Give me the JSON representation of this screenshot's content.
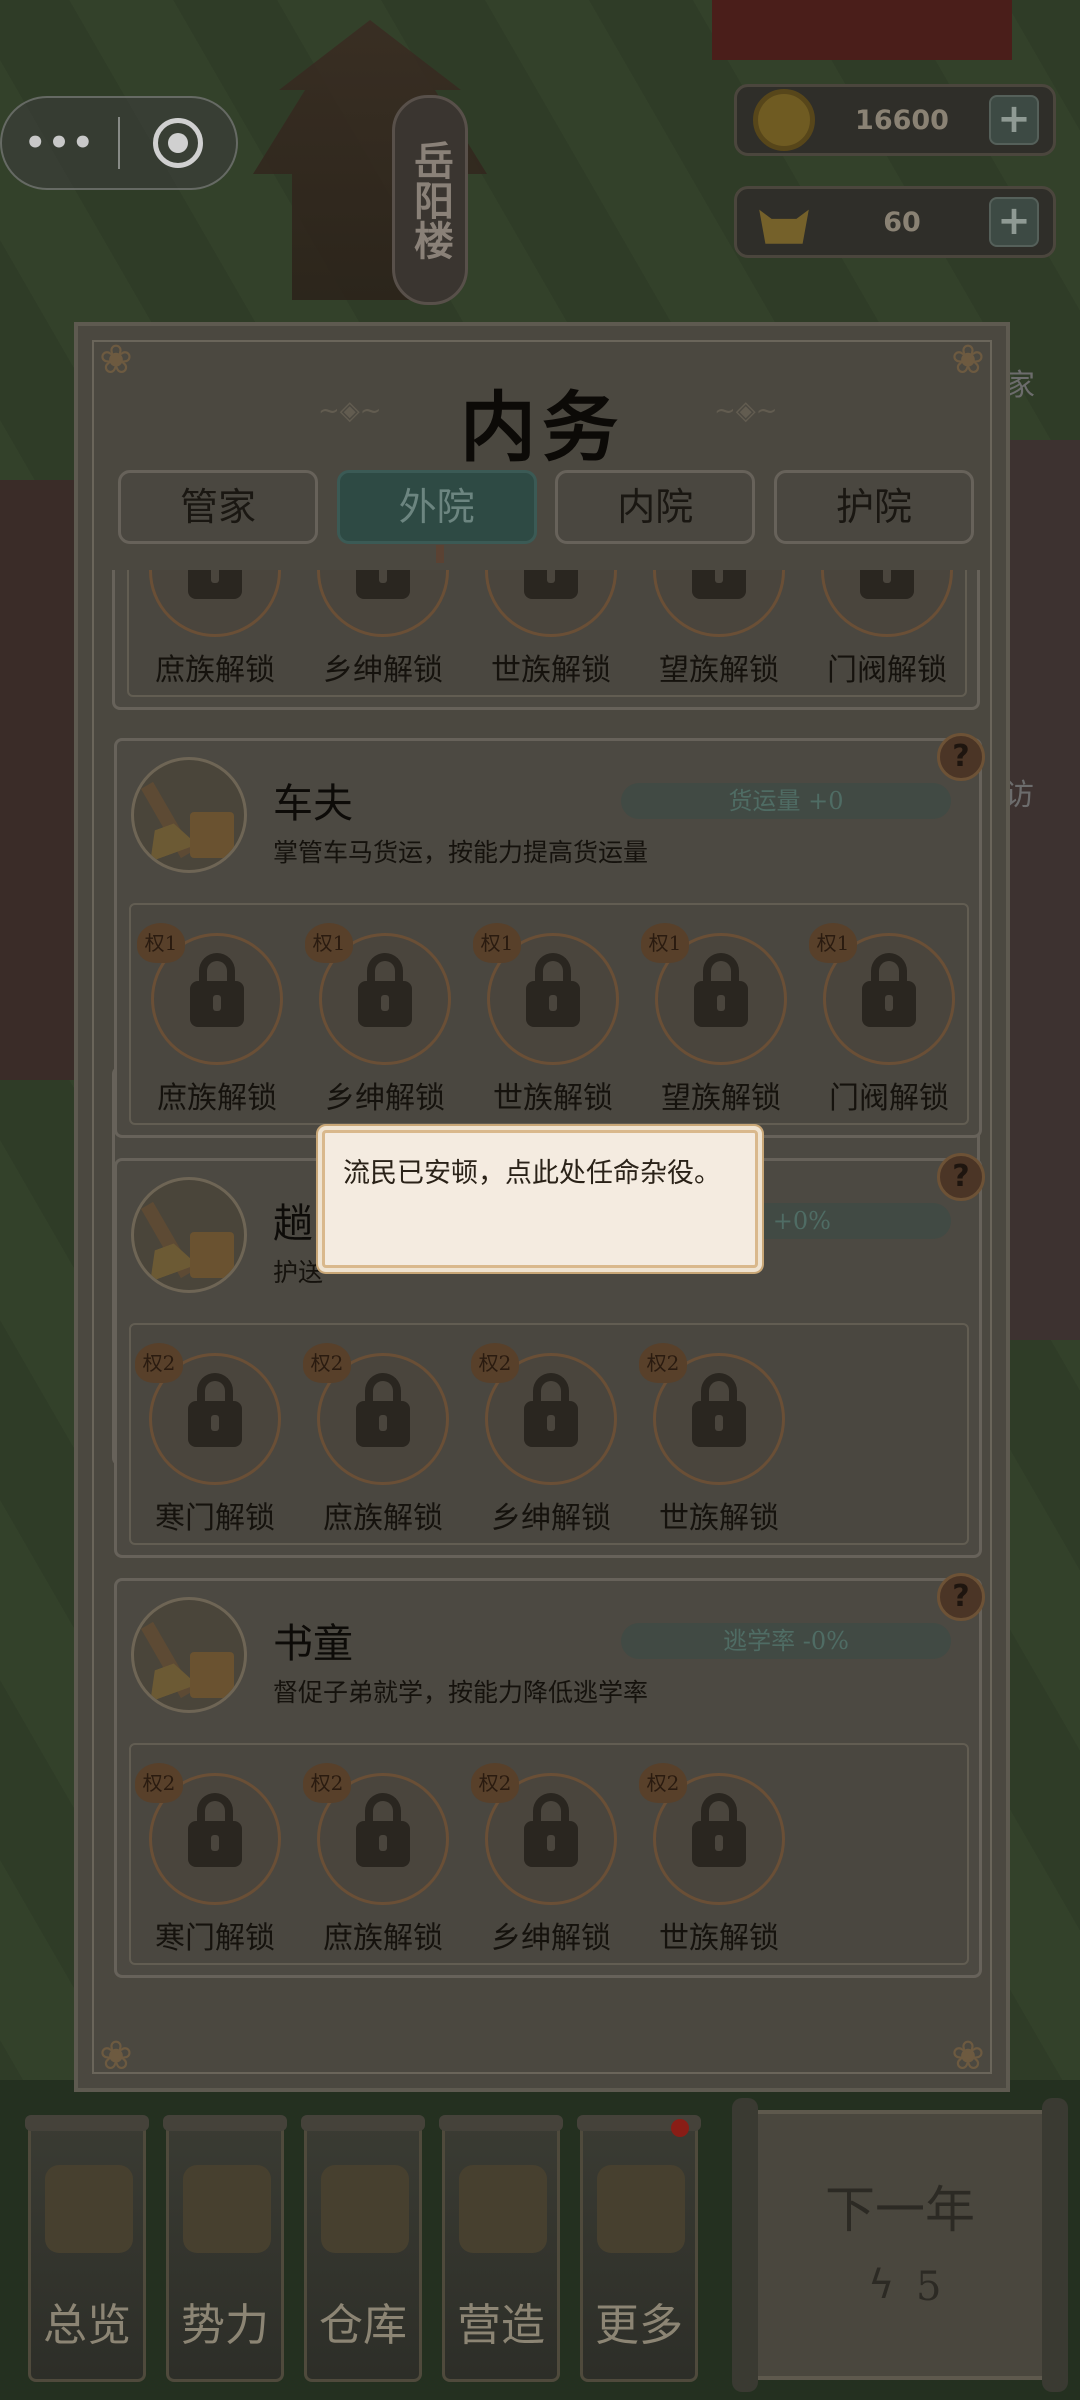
{
  "map": {
    "temple_sign": "岳阳楼"
  },
  "hud": {
    "coins": "16600",
    "gold": "60",
    "coin_icon": "coin-icon",
    "gold_icon": "gold-ingot-icon",
    "plus": "+"
  },
  "side_labels": [
    "家",
    "访"
  ],
  "panel": {
    "title": "内务",
    "tabs": [
      {
        "label": "管家",
        "active": false
      },
      {
        "label": "外院",
        "active": true
      },
      {
        "label": "内院",
        "active": false
      },
      {
        "label": "护院",
        "active": false
      }
    ],
    "sections": [
      {
        "name": "",
        "desc": "",
        "stat": "",
        "slots": [
          {
            "badge": "",
            "label": "庶族解锁"
          },
          {
            "badge": "",
            "label": "乡绅解锁"
          },
          {
            "badge": "",
            "label": "世族解锁"
          },
          {
            "badge": "",
            "label": "望族解锁"
          },
          {
            "badge": "",
            "label": "门阀解锁"
          }
        ]
      },
      {
        "name": "车夫",
        "desc": "掌管车马货运，按能力提高货运量",
        "stat": "货运量 +0",
        "help": "?",
        "slots": [
          {
            "badge": "权1",
            "label": "庶族解锁"
          },
          {
            "badge": "权1",
            "label": "乡绅解锁"
          },
          {
            "badge": "权1",
            "label": "世族解锁"
          },
          {
            "badge": "权1",
            "label": "望族解锁"
          },
          {
            "badge": "权1",
            "label": "门阀解锁"
          }
        ]
      },
      {
        "name": "趟",
        "desc": "护送",
        "stat": "率 +0%",
        "help": "?",
        "slots": [
          {
            "badge": "权2",
            "label": "寒门解锁"
          },
          {
            "badge": "权2",
            "label": "庶族解锁"
          },
          {
            "badge": "权2",
            "label": "乡绅解锁"
          },
          {
            "badge": "权2",
            "label": "世族解锁"
          }
        ]
      },
      {
        "name": "书童",
        "desc": "督促子弟就学，按能力降低逃学率",
        "stat": "逃学率 -0%",
        "help": "?",
        "slots": [
          {
            "badge": "权2",
            "label": "寒门解锁"
          },
          {
            "badge": "权2",
            "label": "庶族解锁"
          },
          {
            "badge": "权2",
            "label": "乡绅解锁"
          },
          {
            "badge": "权2",
            "label": "世族解锁"
          }
        ]
      }
    ]
  },
  "tooltip": "流民已安顿，点此处任命杂役。",
  "bottom_nav": [
    {
      "label": "总览",
      "icon": "overview-icon",
      "dot": false
    },
    {
      "label": "势力",
      "icon": "faction-icon",
      "dot": false
    },
    {
      "label": "仓库",
      "icon": "warehouse-icon",
      "dot": false
    },
    {
      "label": "营造",
      "icon": "build-icon",
      "dot": false
    },
    {
      "label": "更多",
      "icon": "more-icon",
      "dot": true
    }
  ],
  "next_year": {
    "label": "下一年",
    "energy": "5"
  },
  "colors": {
    "accent_teal": "#2e4a44",
    "panel_bg": "#4b4840",
    "tooltip_bg": "#f4ebe0",
    "badge": "#58402a"
  }
}
